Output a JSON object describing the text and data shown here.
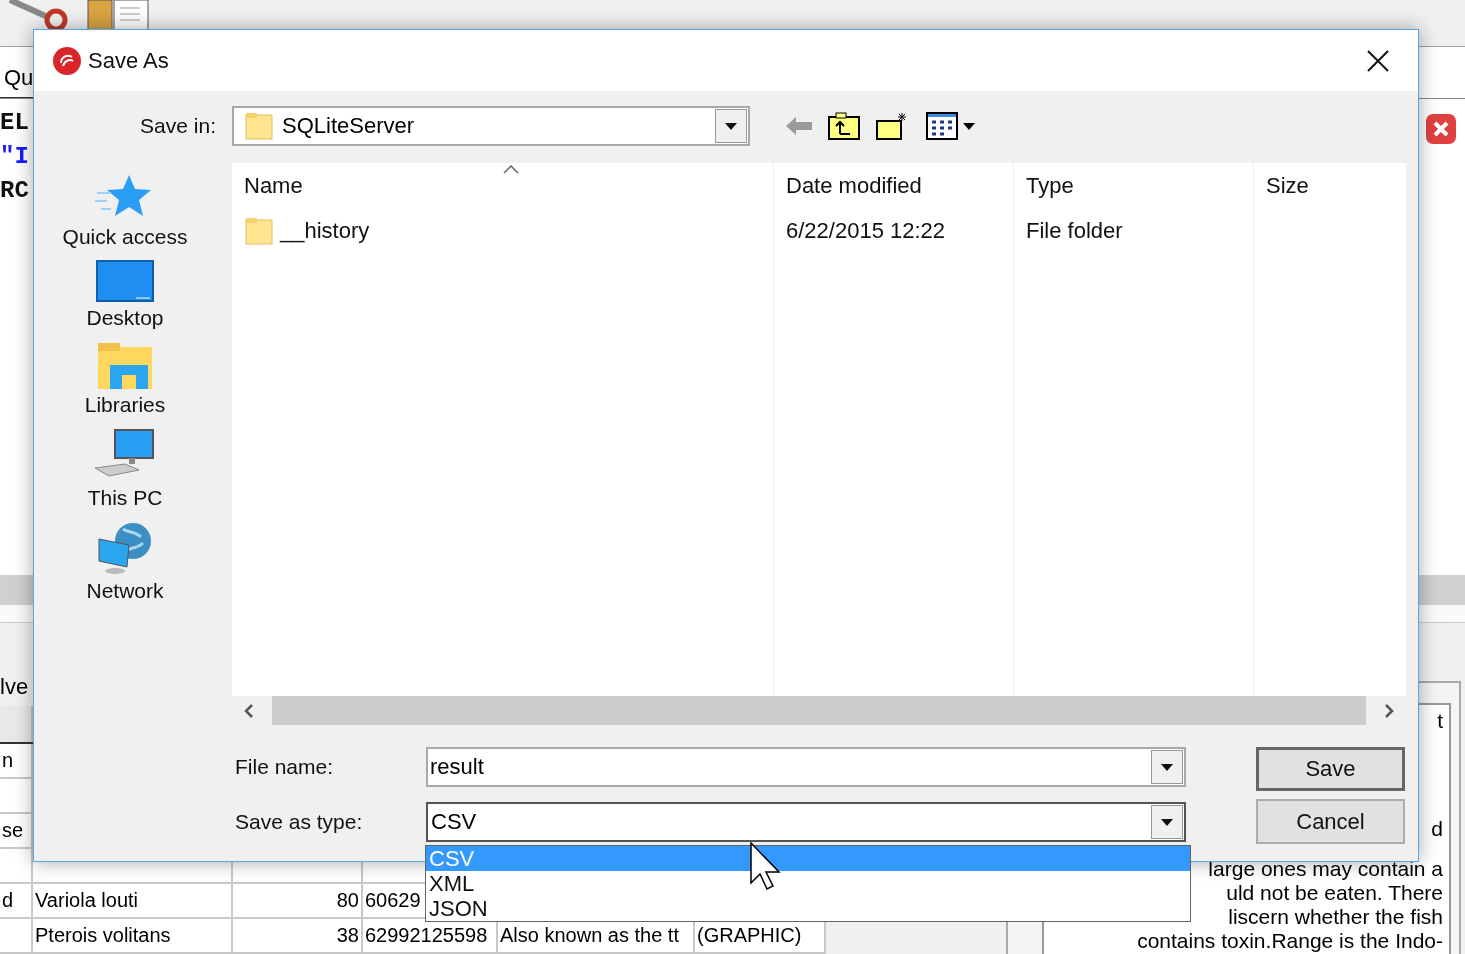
{
  "background": {
    "tab": "Qu",
    "editor_lines": [
      {
        "text": "EL",
        "kind": "keyword"
      },
      {
        "text": "\"I",
        "kind": "string"
      },
      {
        "text": "RC",
        "kind": "keyword"
      }
    ],
    "panel_label": "lve",
    "table_rows": [
      {
        "column_1": "n"
      },
      {},
      {
        "column_1": "se"
      },
      {
        "column_1": "d",
        "column_2": "Variola louti",
        "column_3": "80",
        "column_4": "60629"
      },
      {
        "column_2": "Pterois volitans",
        "column_3": "38",
        "column_4": "62992125598",
        "column_5": "Also known as the tt",
        "column_6": "(GRAPHIC)"
      }
    ],
    "note_lines": [
      {
        "text": "t"
      },
      {
        "text": "d"
      },
      {
        "text": "large ones may contain a"
      },
      {
        "text": "uld not be eaten.  There"
      },
      {
        "text": "liscern whether the fish"
      },
      {
        "text": "contains toxin.Range is the Indo-"
      }
    ]
  },
  "dialog": {
    "title": "Save As",
    "save_in": {
      "label": "Save in:",
      "value": "SQLiteServer"
    },
    "places": [
      {
        "label": "Quick access"
      },
      {
        "label": "Desktop"
      },
      {
        "label": "Libraries"
      },
      {
        "label": "This PC"
      },
      {
        "label": "Network"
      }
    ],
    "columns": [
      {
        "label": "Name",
        "sorted": true
      },
      {
        "label": "Date modified",
        "sorted": false
      },
      {
        "label": "Type",
        "sorted": false
      },
      {
        "label": "Size",
        "sorted": false
      }
    ],
    "files": [
      {
        "name": "__history",
        "date_modified": "6/22/2015 12:22",
        "type": "File folder"
      }
    ],
    "file_name": {
      "label": "File name:",
      "value": "result"
    },
    "save_as_type": {
      "label": "Save as type:",
      "value": "CSV",
      "expanded": true,
      "options": [
        {
          "label": "CSV",
          "selected": true
        },
        {
          "label": "XML",
          "selected": false
        },
        {
          "label": "JSON",
          "selected": false
        }
      ]
    },
    "buttons": [
      {
        "label": "Save",
        "default": true
      },
      {
        "label": "Cancel",
        "default": false
      }
    ]
  }
}
